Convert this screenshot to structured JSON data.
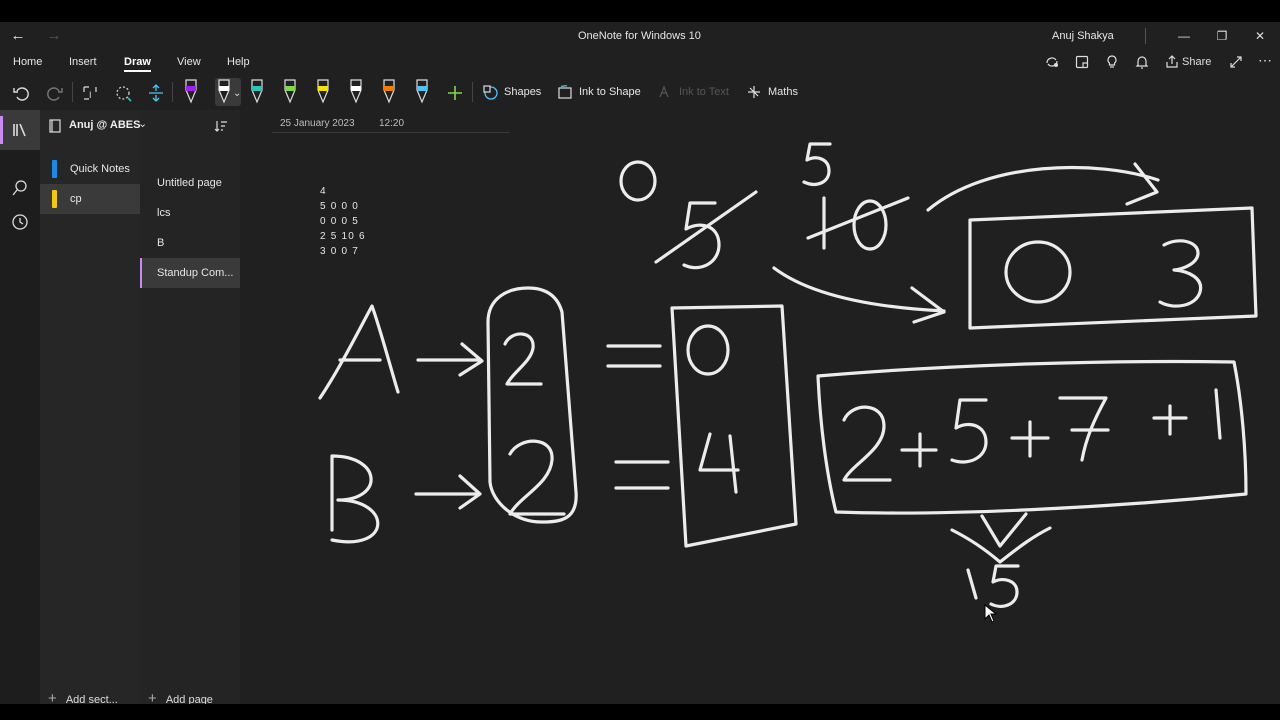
{
  "window": {
    "title": "OneNote for Windows 10",
    "user": "Anuj Shakya"
  },
  "menu": {
    "items": [
      "Home",
      "Insert",
      "Draw",
      "View",
      "Help"
    ],
    "active": "Draw"
  },
  "topright": {
    "share_label": "Share"
  },
  "toolbar": {
    "shapes_label": "Shapes",
    "ink_to_shape_label": "Ink to Shape",
    "ink_to_text_label": "Ink to Text",
    "maths_label": "Maths",
    "pen_colors": [
      "#a020f0",
      "#ffffff",
      "#2ec4b6",
      "#7fd94f",
      "#f5e400",
      "#ffffff",
      "#f57c00",
      "#4fc3f7"
    ]
  },
  "notebook": {
    "name": "Anuj @ ABES",
    "sections": [
      {
        "label": "Quick Notes",
        "color": "#1e88e5"
      },
      {
        "label": "cp",
        "color": "#f2c811"
      }
    ],
    "selected_section": "cp",
    "pages": [
      "Untitled page",
      "lcs",
      "B",
      "Standup Com..."
    ],
    "selected_page": "Standup Com...",
    "add_section_label": "Add sect...",
    "add_page_label": "Add page"
  },
  "page": {
    "date": "25 January 2023",
    "time": "12:20",
    "typed_lines": [
      "4",
      "5 0 0 0",
      "0 0 0 5",
      "2 5 10 6",
      "3 0 0 7"
    ]
  },
  "colors": {
    "accent": "#c78cf2",
    "ink": "#ececec"
  }
}
